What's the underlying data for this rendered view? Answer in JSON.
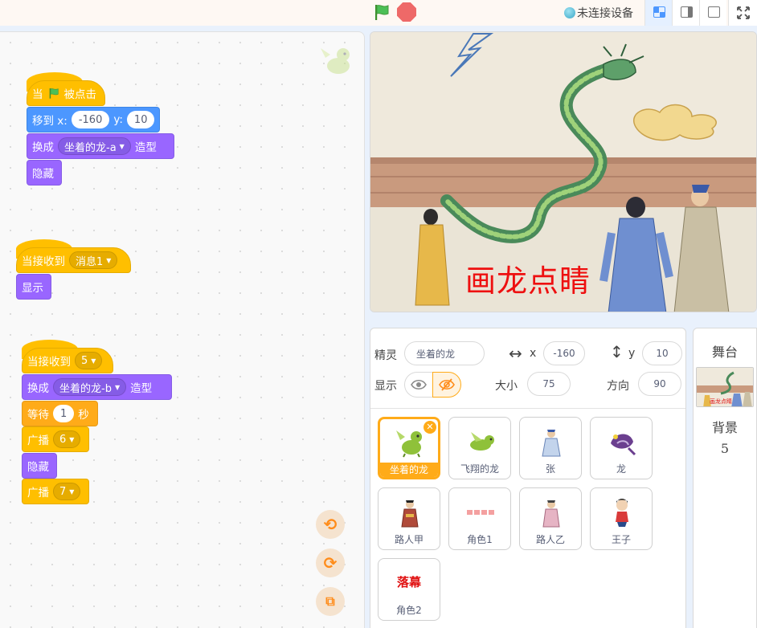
{
  "topbar": {
    "device_status": "未连接设备",
    "icons": [
      "green-flag-icon",
      "stop-icon",
      "small-stage-icon",
      "normal-stage-icon",
      "no-stage-icon",
      "fullscreen-icon"
    ]
  },
  "scripts": {
    "script1": {
      "hat": {
        "prefix": "当",
        "suffix": "被点击"
      },
      "goto": {
        "label": "移到 x:",
        "x": "-160",
        "ylabel": "y:",
        "y": "10"
      },
      "costume": {
        "label": "换成",
        "value": "坐着的龙-a",
        "suffix": "造型"
      },
      "hide": "隐藏"
    },
    "script2": {
      "hat": {
        "label": "当接收到",
        "value": "消息1"
      },
      "show": "显示"
    },
    "script3": {
      "hat": {
        "label": "当接收到",
        "value": "5"
      },
      "costume": {
        "label": "换成",
        "value": "坐着的龙-b",
        "suffix": "造型"
      },
      "wait": {
        "label": "等待",
        "value": "1",
        "suffix": "秒"
      },
      "broadcast1": {
        "label": "广播",
        "value": "6"
      },
      "hide": "隐藏",
      "broadcast2": {
        "label": "广播",
        "value": "7"
      }
    }
  },
  "stage": {
    "title_text": "画龙点睛"
  },
  "sprite_info": {
    "sprite_label": "精灵",
    "sprite_name": "坐着的龙",
    "x_label": "x",
    "x_value": "-160",
    "y_label": "y",
    "y_value": "10",
    "show_label": "显示",
    "size_label": "大小",
    "size_value": "75",
    "direction_label": "方向",
    "direction_value": "90"
  },
  "sprites": [
    {
      "name": "坐着的龙",
      "selected": true,
      "icon": "sitting-dragon-icon"
    },
    {
      "name": "飞翔的龙",
      "selected": false,
      "icon": "flying-dragon-icon"
    },
    {
      "name": "张",
      "selected": false,
      "icon": "zhang-person-icon"
    },
    {
      "name": "龙",
      "selected": false,
      "icon": "dragon-icon"
    },
    {
      "name": "路人甲",
      "selected": false,
      "icon": "passerby-a-icon"
    },
    {
      "name": "角色1",
      "selected": false,
      "icon": "title-text-icon"
    },
    {
      "name": "路人乙",
      "selected": false,
      "icon": "passerby-b-icon"
    },
    {
      "name": "王子",
      "selected": false,
      "icon": "prince-icon"
    },
    {
      "name": "角色2",
      "selected": false,
      "icon": "curtain-text-icon",
      "thumb_text": "落幕"
    }
  ],
  "stage_panel": {
    "title": "舞台",
    "backdrop_label": "背景",
    "backdrop_count": "5",
    "thumb_text": "画龙点睛"
  },
  "colors": {
    "event": "#ffbf00",
    "motion": "#4c97ff",
    "looks": "#9966ff",
    "control": "#ffab19",
    "selected_sprite": "#ffab19"
  }
}
